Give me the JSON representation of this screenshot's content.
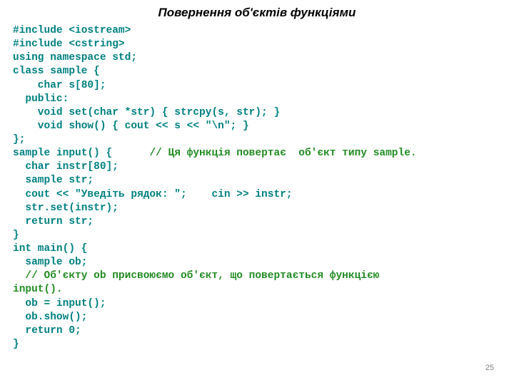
{
  "title": "Повернення об'єктів функціями",
  "slide_number": "25",
  "lines": [
    {
      "segments": [
        {
          "text": "#include <iostream>",
          "cls": "teal"
        }
      ]
    },
    {
      "segments": [
        {
          "text": "#include <cstring>",
          "cls": "teal"
        }
      ]
    },
    {
      "segments": [
        {
          "text": "using namespace std;",
          "cls": "teal"
        }
      ]
    },
    {
      "segments": [
        {
          "text": "class sample {",
          "cls": "teal"
        }
      ]
    },
    {
      "segments": [
        {
          "text": "    char s[80];",
          "cls": "teal"
        }
      ]
    },
    {
      "segments": [
        {
          "text": "  public:",
          "cls": "teal"
        }
      ]
    },
    {
      "segments": [
        {
          "text": "    void set(char *str) { strcpy(s, str); }",
          "cls": "teal"
        }
      ]
    },
    {
      "segments": [
        {
          "text": "    void show() { cout << s << \"\\n\"; }",
          "cls": "teal"
        }
      ]
    },
    {
      "segments": [
        {
          "text": "};",
          "cls": "teal"
        }
      ]
    },
    {
      "segments": [
        {
          "text": "sample input() {      ",
          "cls": "teal"
        },
        {
          "text": "// Ця функція повертає  об'єкт типу sample.",
          "cls": "green"
        }
      ]
    },
    {
      "segments": [
        {
          "text": "  char instr[80];",
          "cls": "teal"
        }
      ]
    },
    {
      "segments": [
        {
          "text": "  sample str;",
          "cls": "teal"
        }
      ]
    },
    {
      "segments": [
        {
          "text": "  cout << \"Уведіть рядок: \";    cin >> instr;",
          "cls": "teal"
        }
      ]
    },
    {
      "segments": [
        {
          "text": "  str.set(instr);",
          "cls": "teal"
        }
      ]
    },
    {
      "segments": [
        {
          "text": "  return str;",
          "cls": "teal"
        }
      ]
    },
    {
      "segments": [
        {
          "text": "}",
          "cls": "teal"
        }
      ]
    },
    {
      "segments": [
        {
          "text": "int main() {",
          "cls": "teal"
        }
      ]
    },
    {
      "segments": [
        {
          "text": "  sample ob;",
          "cls": "teal"
        }
      ]
    },
    {
      "segments": [
        {
          "text": "  ",
          "cls": "teal"
        },
        {
          "text": "// Об'єкту ob присвоюємо об'єкт, що повертається функцією",
          "cls": "green"
        }
      ]
    },
    {
      "segments": [
        {
          "text": "input().",
          "cls": "green"
        }
      ]
    },
    {
      "segments": [
        {
          "text": "  ob = input();",
          "cls": "teal"
        }
      ]
    },
    {
      "segments": [
        {
          "text": "  ob.show();",
          "cls": "teal"
        }
      ]
    },
    {
      "segments": [
        {
          "text": "  return 0;",
          "cls": "teal"
        }
      ]
    },
    {
      "segments": [
        {
          "text": "}",
          "cls": "teal"
        }
      ]
    }
  ]
}
